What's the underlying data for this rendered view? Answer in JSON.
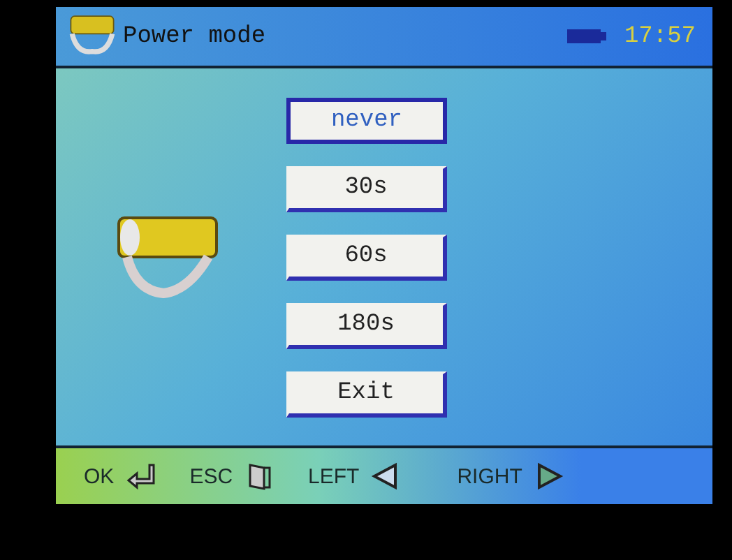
{
  "header": {
    "title": "Power mode",
    "time": "17:57"
  },
  "options": [
    {
      "label": "never",
      "selected": true
    },
    {
      "label": "30s",
      "selected": false
    },
    {
      "label": "60s",
      "selected": false
    },
    {
      "label": "180s",
      "selected": false
    },
    {
      "label": "Exit",
      "selected": false
    }
  ],
  "footer": [
    {
      "label": "OK",
      "kind": "enter"
    },
    {
      "label": "ESC",
      "kind": "door"
    },
    {
      "label": "LEFT",
      "kind": "left"
    },
    {
      "label": "RIGHT",
      "kind": "right"
    }
  ]
}
